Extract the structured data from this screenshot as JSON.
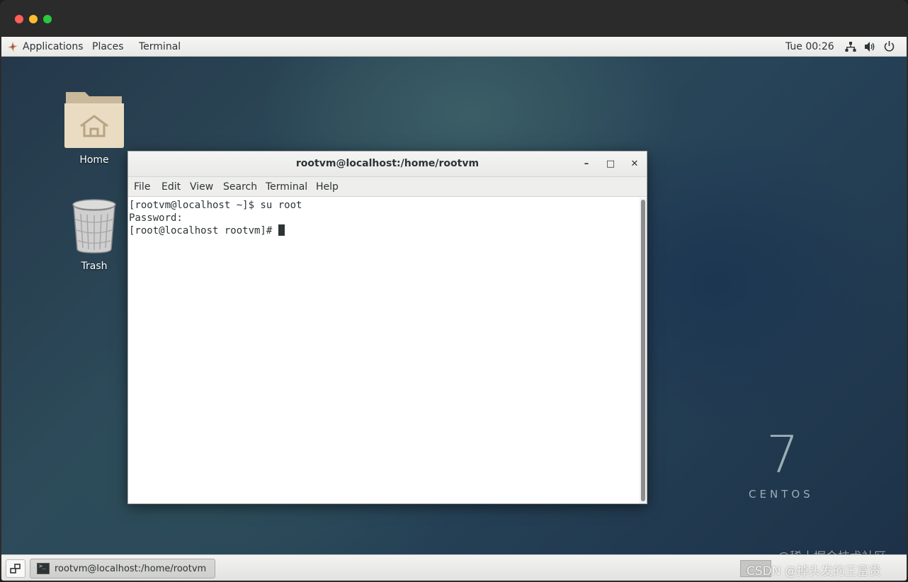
{
  "topbar": {
    "applications": "Applications",
    "places": "Places",
    "terminal": "Terminal",
    "clock": "Tue 00:26",
    "network_icon": "network-icon",
    "volume_icon": "volume-icon",
    "power_icon": "power-icon"
  },
  "desktop": {
    "icons": [
      {
        "label": "Home",
        "icon": "home-folder-icon"
      },
      {
        "label": "Trash",
        "icon": "trash-icon"
      }
    ],
    "branding": {
      "number": "7",
      "text": "CENTOS"
    }
  },
  "terminal_window": {
    "title": "rootvm@localhost:/home/rootvm",
    "controls": {
      "minimize": "–",
      "maximize": "□",
      "close": "✕"
    },
    "menu": [
      "File",
      "Edit",
      "View",
      "Search",
      "Terminal",
      "Help"
    ],
    "lines": [
      "[rootvm@localhost ~]$ su root",
      "Password:",
      "[root@localhost rootvm]# "
    ]
  },
  "taskbar": {
    "task_label": "rootvm@localhost:/home/rootvm"
  },
  "watermark": {
    "line1": "@稀土掘金技术社区",
    "line2": "CSDN @掉头发的王富贵"
  }
}
